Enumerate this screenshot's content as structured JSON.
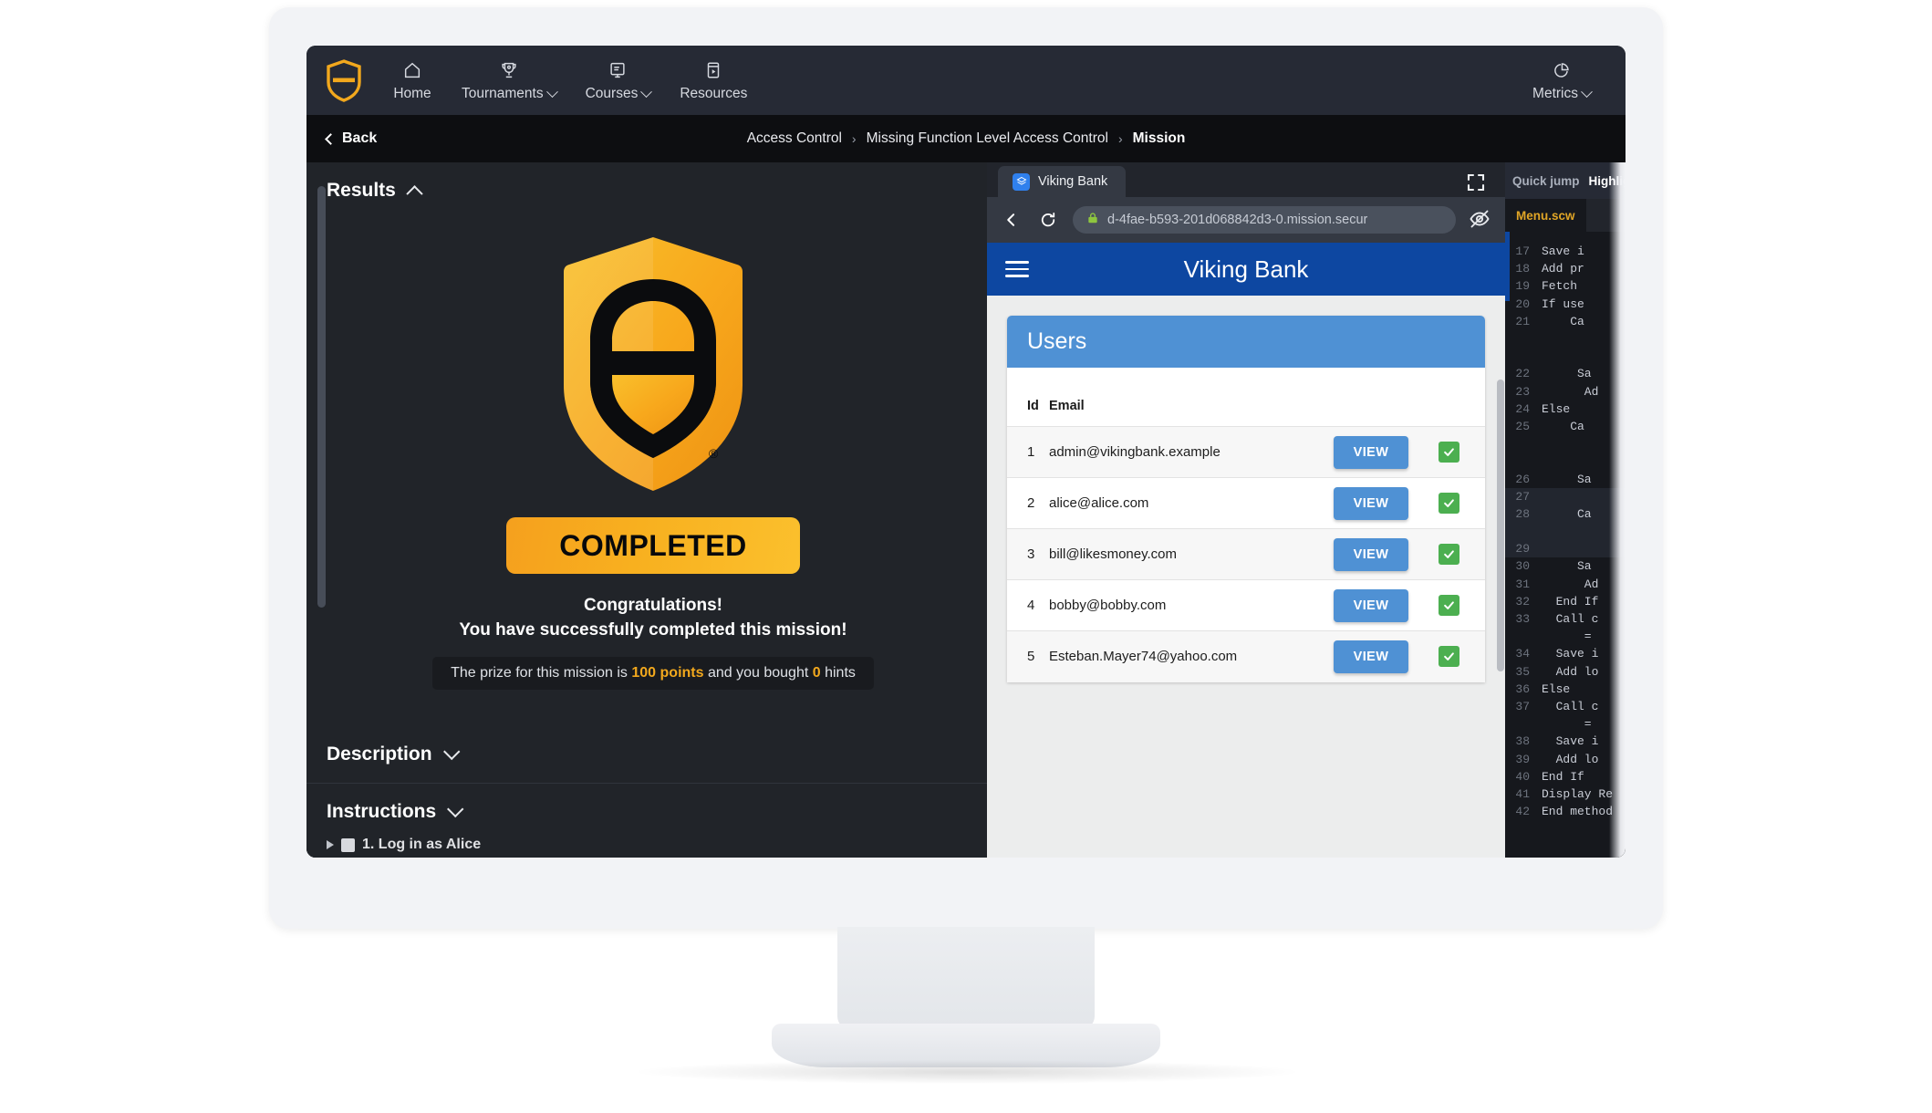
{
  "topnav": {
    "logo_icon": "secure-code-warrior-shield-logo",
    "items": [
      {
        "label": "Home",
        "icon": "home-icon",
        "has_caret": false
      },
      {
        "label": "Tournaments",
        "icon": "trophy-icon",
        "has_caret": true
      },
      {
        "label": "Courses",
        "icon": "course-card-icon",
        "has_caret": true
      },
      {
        "label": "Resources",
        "icon": "play-window-icon",
        "has_caret": false
      }
    ],
    "right": {
      "label": "Metrics",
      "icon": "pie-chart-icon",
      "has_caret": true
    }
  },
  "crumbbar": {
    "back_label": "Back",
    "back_icon": "chevron-left-icon",
    "breadcrumb": [
      "Access Control",
      "Missing Function Level Access Control",
      "Mission"
    ],
    "separator": "›"
  },
  "results": {
    "title": "Results",
    "collapse_icon": "chevron-up-icon",
    "badge_label": "COMPLETED",
    "shield_icon": "secure-code-warrior-shield",
    "congrats_line1": "Congratulations!",
    "congrats_line2": "You have successfully completed this mission!",
    "prize": {
      "prefix": "The prize for this mission is ",
      "points": "100 points",
      "middle": " and you bought ",
      "hints_count": "0",
      "suffix": " hints"
    }
  },
  "description": {
    "title": "Description",
    "expand_icon": "chevron-down-icon"
  },
  "instructions": {
    "title": "Instructions",
    "expand_icon": "chevron-down-icon",
    "first_step": "1. Log in as Alice"
  },
  "browser": {
    "tab": {
      "title": "Viking Bank",
      "favicon": "layers-icon"
    },
    "fullscreen_icon": "fullscreen-expand-icon",
    "back_icon": "chevron-left-icon",
    "reload_icon": "reload-icon",
    "lock_icon": "padlock-icon",
    "url": "d-4fae-b593-201d068842d3-0.mission.secur",
    "eye_icon": "eye-off-icon"
  },
  "viking_bank": {
    "app_title": "Viking Bank",
    "menu_icon": "hamburger-menu-icon",
    "card_title": "Users",
    "columns": [
      "Id",
      "Email"
    ],
    "action_label": "VIEW",
    "status_icon": "green-check-icon",
    "rows": [
      {
        "id": "1",
        "email": "admin@vikingbank.example"
      },
      {
        "id": "2",
        "email": "alice@alice.com"
      },
      {
        "id": "3",
        "email": "bill@likesmoney.com"
      },
      {
        "id": "4",
        "email": "bobby@bobby.com"
      },
      {
        "id": "5",
        "email": "Esteban.Mayer74@yahoo.com"
      }
    ]
  },
  "code_panel": {
    "quick_jump_label": "Quick jump",
    "highlighted_label": "Highlighted",
    "file_tab": "Menu.scw",
    "lines": [
      {
        "n": "17",
        "text": "Save i"
      },
      {
        "n": "18",
        "text": "Add pr"
      },
      {
        "n": "19",
        "text": "Fetch "
      },
      {
        "n": "20",
        "text": "If use"
      },
      {
        "n": "21",
        "text": "    Ca"
      },
      {
        "n": "",
        "text": ""
      },
      {
        "n": "",
        "text": ""
      },
      {
        "n": "22",
        "text": "     Sa"
      },
      {
        "n": "23",
        "text": "      Ad"
      },
      {
        "n": "24",
        "text": "Else"
      },
      {
        "n": "25",
        "text": "    Ca"
      },
      {
        "n": "",
        "text": ""
      },
      {
        "n": "",
        "text": ""
      },
      {
        "n": "26",
        "text": "     Sa"
      },
      {
        "n": "27",
        "text": ""
      },
      {
        "n": "28",
        "text": "     Ca"
      },
      {
        "n": "",
        "text": ""
      },
      {
        "n": "29",
        "text": ""
      },
      {
        "n": "30",
        "text": "     Sa"
      },
      {
        "n": "31",
        "text": "      Ad"
      },
      {
        "n": "32",
        "text": "  End If"
      },
      {
        "n": "33",
        "text": "  Call c"
      },
      {
        "n": "",
        "text": "      ="
      },
      {
        "n": "34",
        "text": "  Save i"
      },
      {
        "n": "35",
        "text": "  Add lo"
      },
      {
        "n": "36",
        "text": "Else"
      },
      {
        "n": "37",
        "text": "  Call c"
      },
      {
        "n": "",
        "text": "      ="
      },
      {
        "n": "38",
        "text": "  Save i"
      },
      {
        "n": "39",
        "text": "  Add lo"
      },
      {
        "n": "40",
        "text": "End If"
      },
      {
        "n": "41",
        "text": "Display Re"
      },
      {
        "n": "42",
        "text": "End method"
      }
    ]
  },
  "colors": {
    "brand_orange": "#F2A81D",
    "nav_dark": "#262A35",
    "panel_dark": "#212429",
    "bank_blue": "#0D47A1",
    "card_blue": "#4F91D4",
    "status_green": "#4CAF50"
  }
}
